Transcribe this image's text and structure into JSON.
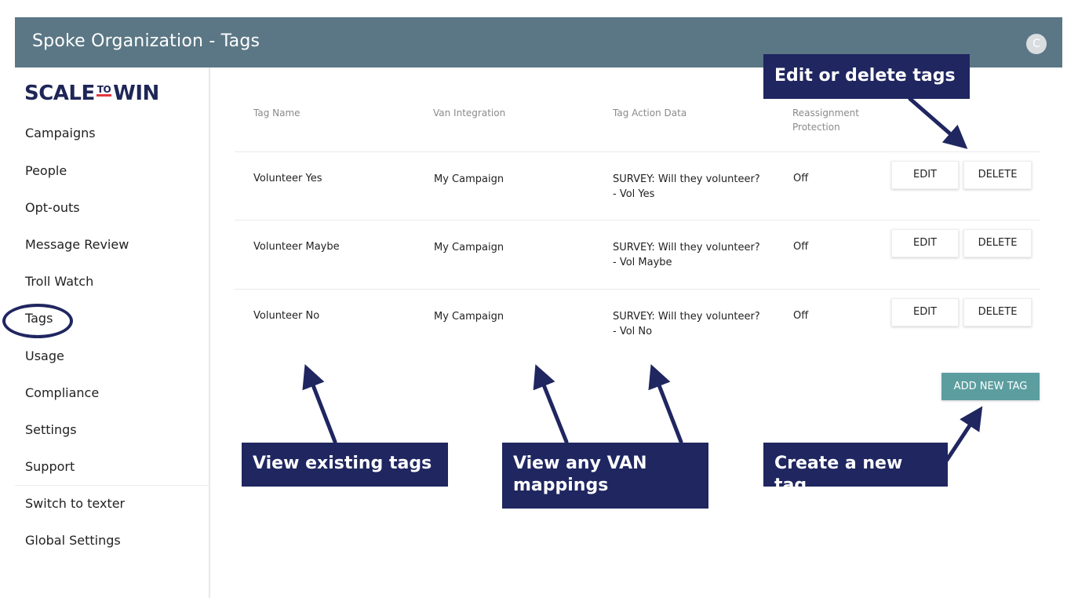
{
  "header": {
    "title": "Spoke Organization - Tags",
    "avatar_initial": "C",
    "bg_color": "#5b7785"
  },
  "sidebar": {
    "logo_left": "SCALE",
    "logo_mid": "TO",
    "logo_right": "WIN",
    "items": [
      {
        "label": "Campaigns"
      },
      {
        "label": "People"
      },
      {
        "label": "Opt-outs"
      },
      {
        "label": "Message Review"
      },
      {
        "label": "Troll Watch"
      },
      {
        "label": "Tags"
      },
      {
        "label": "Usage"
      },
      {
        "label": "Compliance"
      },
      {
        "label": "Settings"
      },
      {
        "label": "Support"
      },
      {
        "label": "Switch to texter"
      },
      {
        "label": "Global Settings"
      }
    ]
  },
  "table": {
    "headers": {
      "tag_name": "Tag Name",
      "van_integration": "Van Integration",
      "tag_action_data": "Tag Action Data",
      "reassignment_line1": "Reassignment",
      "reassignment_line2": "Protection"
    },
    "rows": [
      {
        "name": "Volunteer Yes",
        "van": "My Campaign",
        "action_line1": "SURVEY: Will they volunteer?",
        "action_line2": "- Vol Yes",
        "protection": "Off",
        "edit": "EDIT",
        "delete": "DELETE"
      },
      {
        "name": "Volunteer Maybe",
        "van": "My Campaign",
        "action_line1": "SURVEY: Will they volunteer?",
        "action_line2": "- Vol Maybe",
        "protection": "Off",
        "edit": "EDIT",
        "delete": "DELETE"
      },
      {
        "name": "Volunteer No",
        "van": "My Campaign",
        "action_line1": "SURVEY: Will they volunteer?",
        "action_line2": "- Vol No",
        "protection": "Off",
        "edit": "EDIT",
        "delete": "DELETE"
      }
    ],
    "add_button": "ADD NEW TAG"
  },
  "callouts": {
    "edit_delete": "Edit or delete tags",
    "view_tags": "View existing tags",
    "van_line1": "View any VAN",
    "van_line2": "mappings",
    "create": "Create a new tag"
  },
  "colors": {
    "callout_bg": "#1f2660",
    "add_button_bg": "#5c9ea0"
  }
}
